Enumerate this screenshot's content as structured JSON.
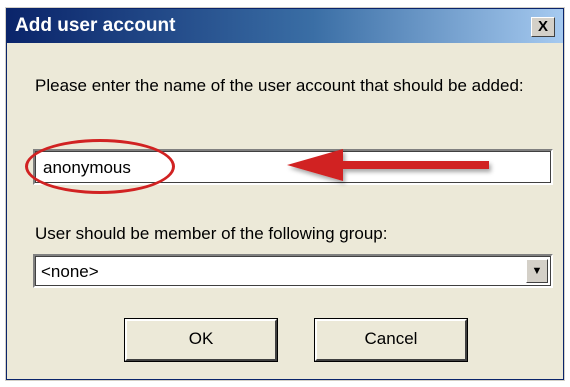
{
  "dialog": {
    "title": "Add user account",
    "close_glyph": "X",
    "prompt": "Please enter the name of the user account that should be added:",
    "username_value": "anonymous",
    "group_label": "User should be member of the following group:",
    "group_selected": "<none>",
    "ok_label": "OK",
    "cancel_label": "Cancel"
  },
  "annotation": {
    "highlight_color": "#d12222",
    "arrow_color": "#d12222"
  }
}
